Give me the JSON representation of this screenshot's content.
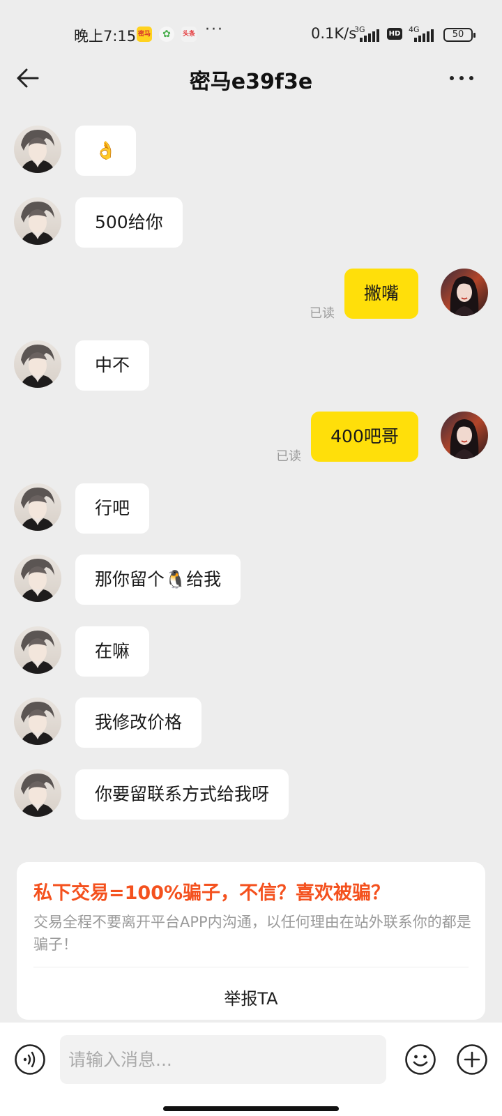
{
  "status_bar": {
    "time": "晚上7:15",
    "app_icon_1": "密马",
    "app_icon_2": "✿",
    "app_icon_3": "头条",
    "more_dots": "···",
    "net_speed": "0.1K/s",
    "sim1_type": "3G",
    "hd_badge": "HD",
    "sim2_type": "4G",
    "battery": "50"
  },
  "header": {
    "title": "密马e39f3e",
    "back_icon": "arrow-left-icon",
    "more_icon": "more-dots-icon"
  },
  "messages": [
    {
      "side": "left",
      "text": "👌"
    },
    {
      "side": "left",
      "text": "500给你"
    },
    {
      "side": "right",
      "text": "撇嘴",
      "read": "已读"
    },
    {
      "side": "left",
      "text": "中不"
    },
    {
      "side": "right",
      "text": "400吧哥",
      "read": "已读"
    },
    {
      "side": "left",
      "text": "行吧"
    },
    {
      "side": "left",
      "text": "那你留个🐧给我"
    },
    {
      "side": "left",
      "text": "在嘛"
    },
    {
      "side": "left",
      "text": "我修改价格"
    },
    {
      "side": "left",
      "text": "你要留联系方式给我呀"
    }
  ],
  "warning": {
    "title": "私下交易=100%骗子，不信？喜欢被骗？",
    "body": "交易全程不要离开平台APP内沟通，以任何理由在站外联系你的都是骗子！",
    "report_label": "举报TA"
  },
  "input_bar": {
    "placeholder": "请输入消息...",
    "value": "",
    "voice_icon": "voice-icon",
    "emoji_icon": "emoji-icon",
    "plus_icon": "plus-icon"
  },
  "colors": {
    "background": "#ededed",
    "own_bubble": "#ffdf0a",
    "other_bubble": "#ffffff",
    "warning_title": "#f4511e"
  }
}
